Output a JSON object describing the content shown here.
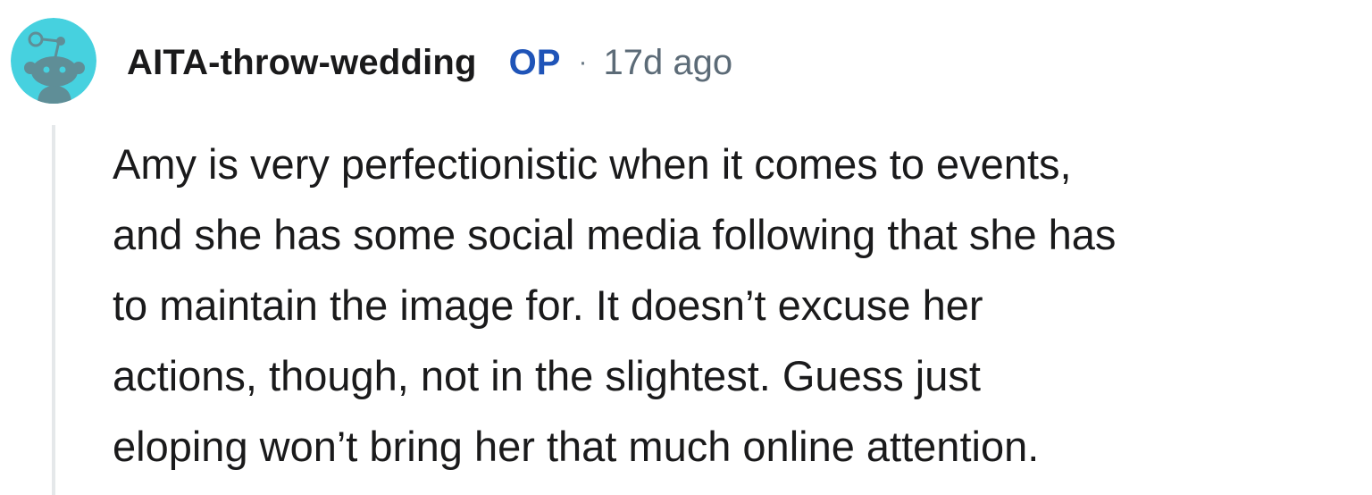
{
  "comment": {
    "author": "AITA-throw-wedding",
    "badge": "OP",
    "separator": "·",
    "timestamp": "17d ago",
    "avatar_icon": "snoo-avatar-icon",
    "colors": {
      "avatar_bg": "#46d1df",
      "avatar_figure": "#5f8e97",
      "op_badge": "#1f54b8",
      "text": "#1a1a1b",
      "meta": "#5c6b77",
      "thread_line": "#e5e8ea"
    },
    "body_lines": [
      "Amy is very perfectionistic when it comes to events,",
      "and she has some social media following that she has",
      "to maintain the image for. It doesn’t excuse her",
      "actions, though, not in the slightest. Guess just",
      "eloping won’t bring her that much online attention."
    ]
  }
}
